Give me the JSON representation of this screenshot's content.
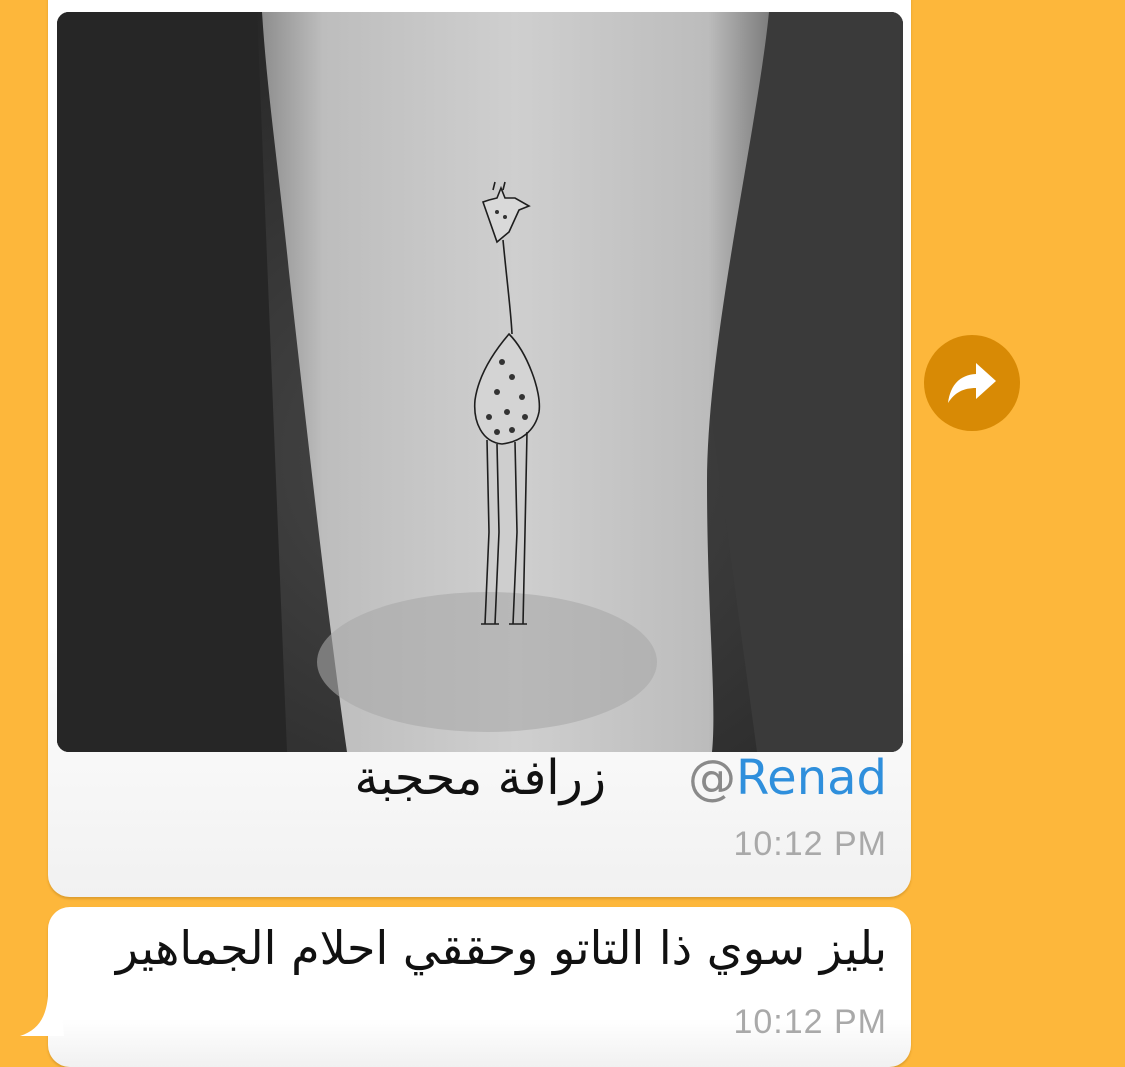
{
  "message_photo": {
    "image_alt": "giraffe tattoo on ankle",
    "caption_mention_at": "@",
    "caption_mention_name": "Renad",
    "caption_text": "زرافة محجبة",
    "time": "10:12 PM"
  },
  "message_text": {
    "text": "بليز سوي ذا التاتو وحققي احلام الجماهير",
    "time": "10:12 PM"
  },
  "forward_button": {
    "icon": "forward-arrow-icon"
  },
  "colors": {
    "background": "#FDB73B",
    "bubble": "#FFFFFF",
    "mention": "#2F8FDC",
    "forward_button": "#D88A05",
    "timestamp": "#A9A9A9"
  }
}
